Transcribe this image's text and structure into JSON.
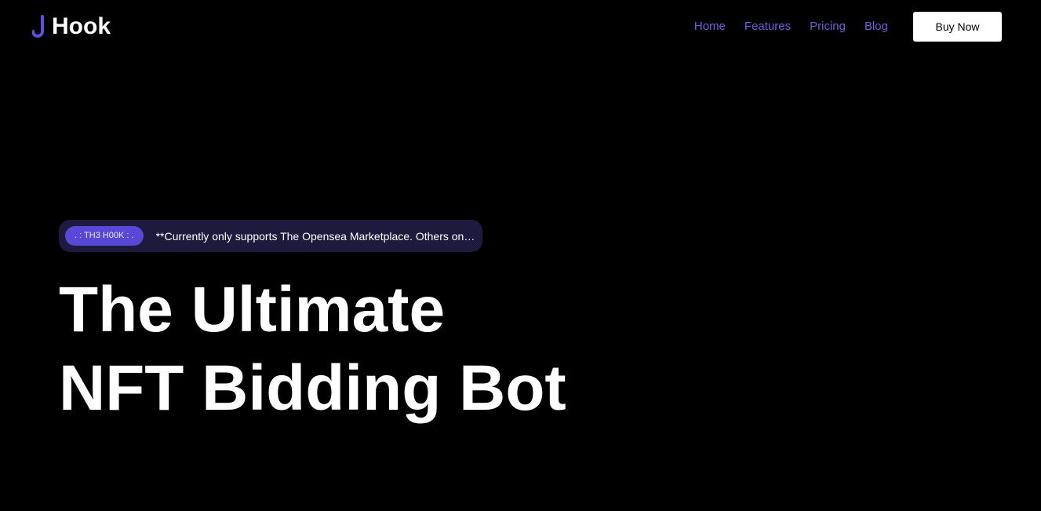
{
  "brand": {
    "name": "Hook",
    "icon": "hook-icon",
    "accent_color": "#5b4fe0"
  },
  "nav": {
    "items": [
      {
        "label": "Home"
      },
      {
        "label": "Features"
      },
      {
        "label": "Pricing"
      },
      {
        "label": "Blog"
      }
    ],
    "link_color": "#6a5ee0"
  },
  "header": {
    "cta_label": "Buy Now"
  },
  "announcement": {
    "tag": ". : TH3 H00K : .",
    "text": "**Currently only supports The Opensea Marketplace. Others on way..."
  },
  "hero": {
    "title_line1": "The Ultimate",
    "title_line2": "NFT Bidding Bot"
  }
}
